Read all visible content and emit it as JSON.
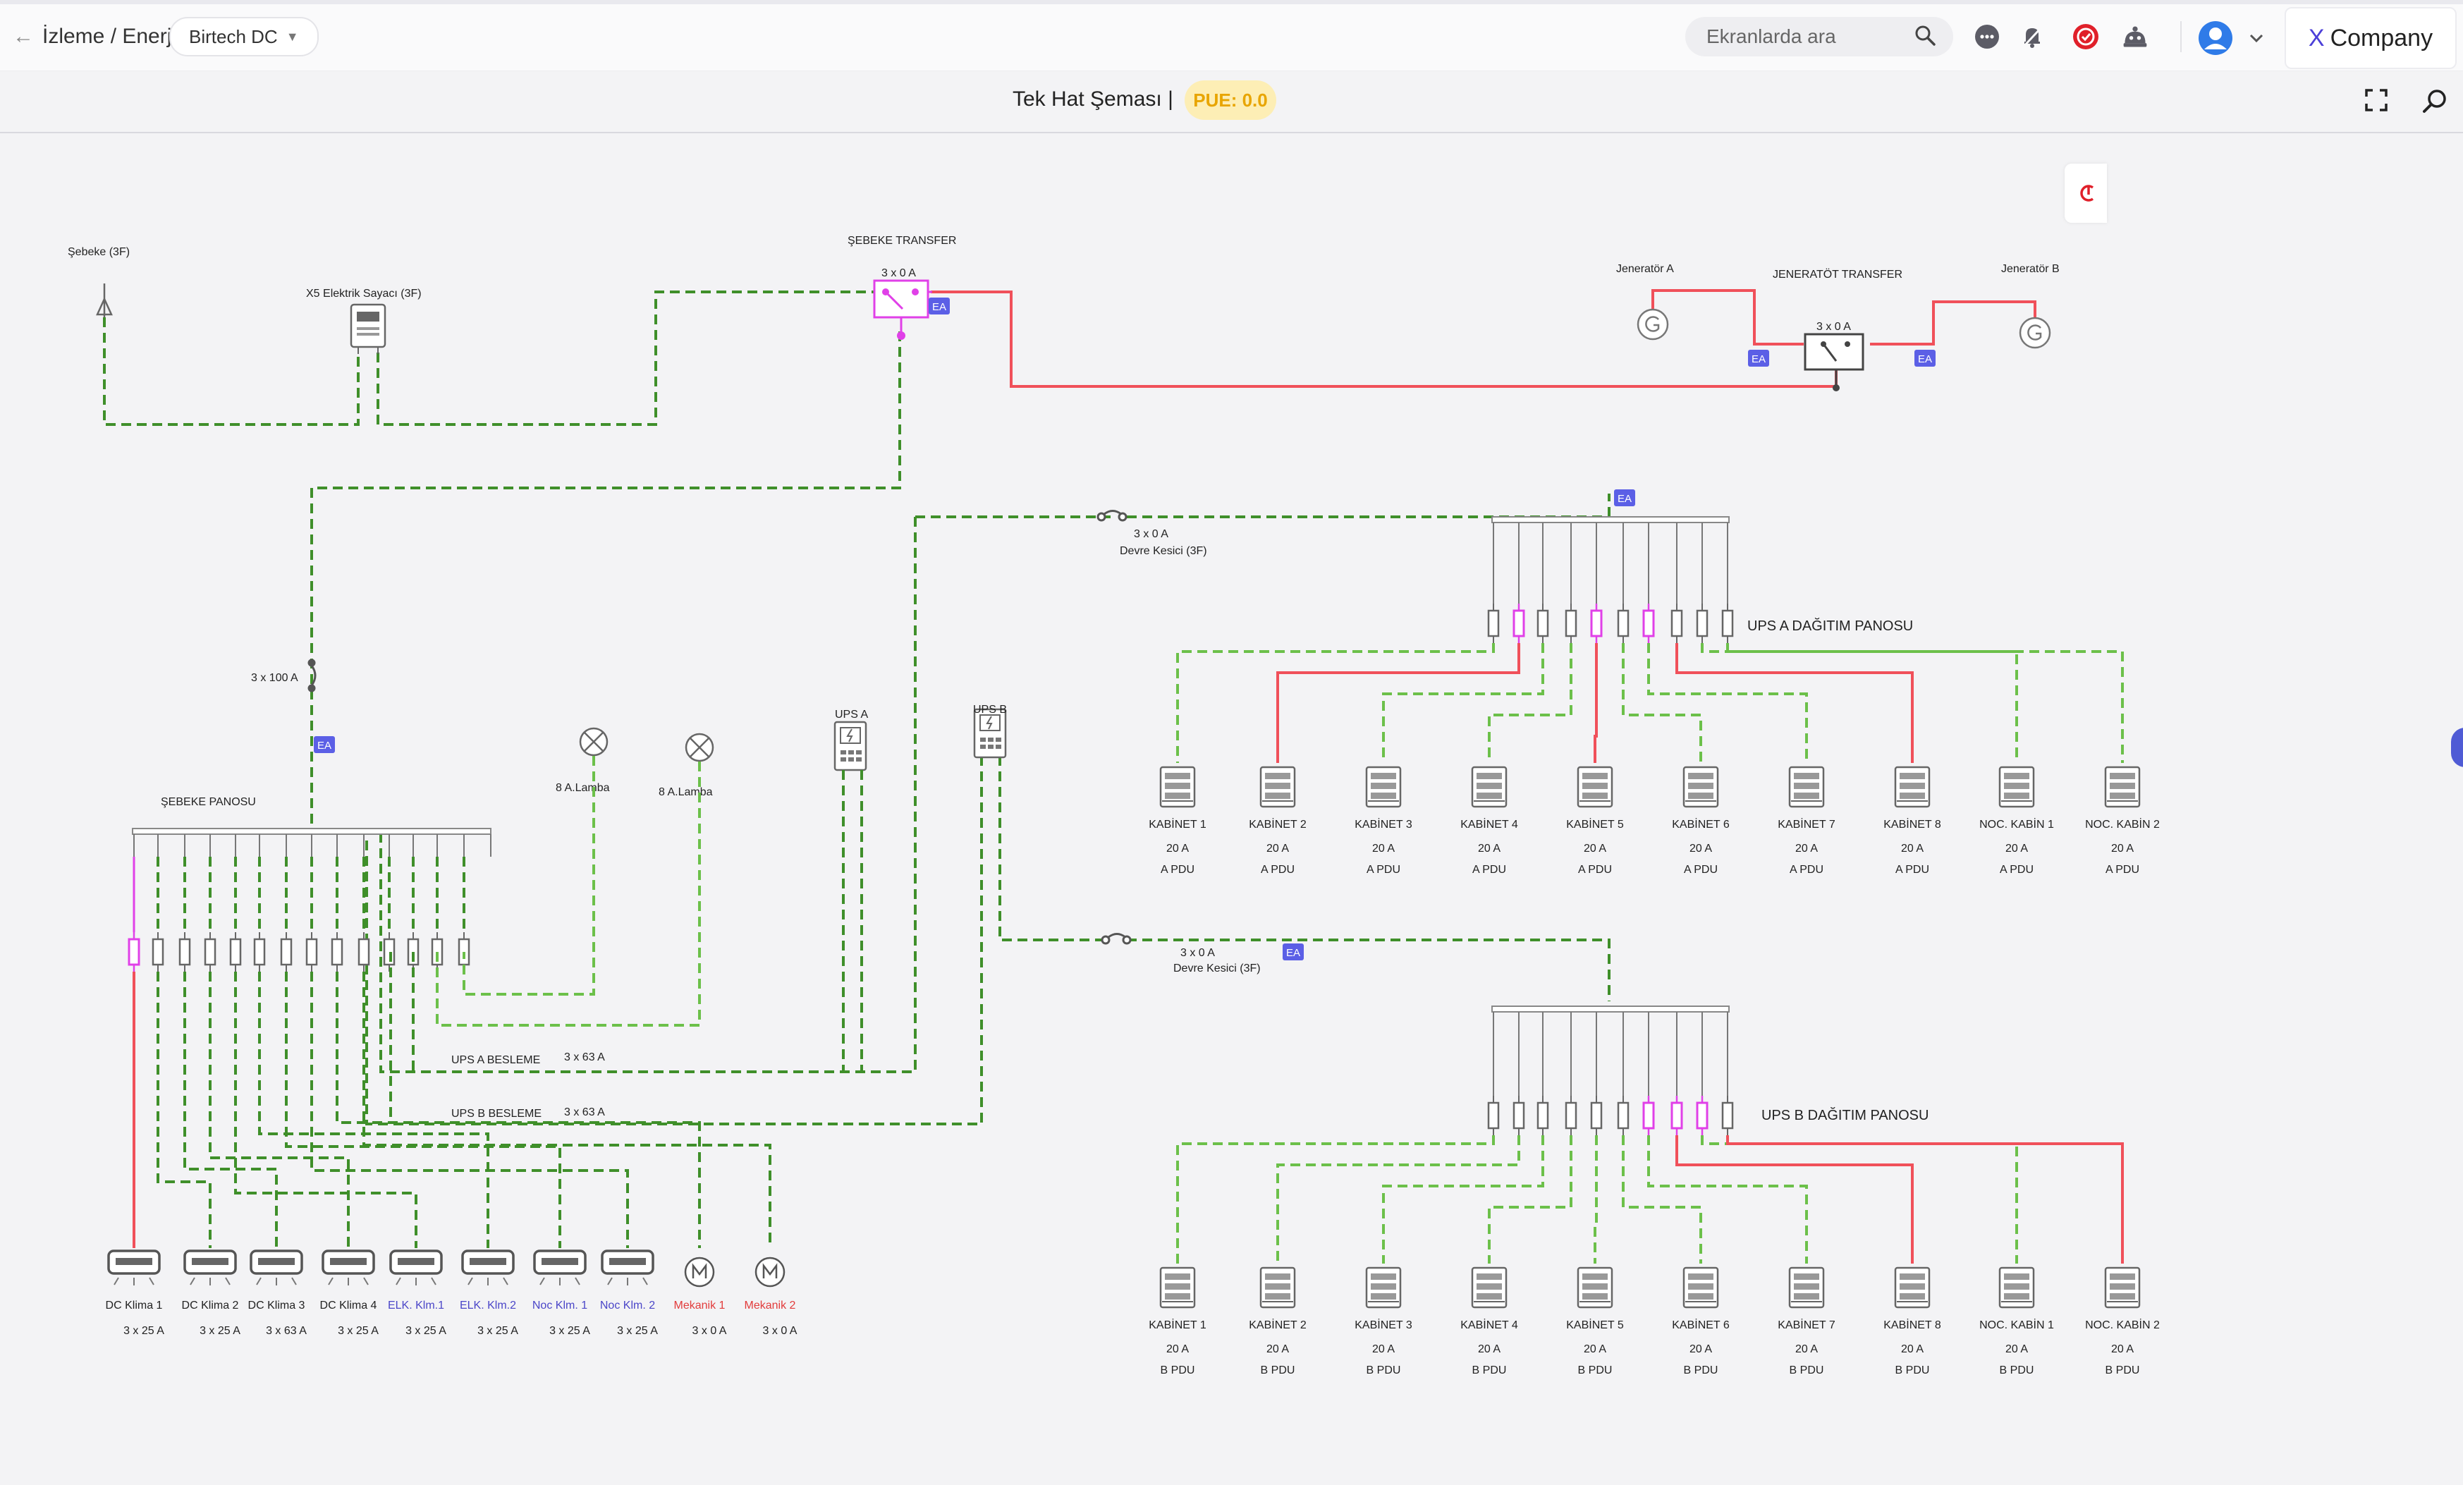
{
  "header": {
    "breadcrumb": "İzleme / Enerji",
    "datacenter": "Birtech DC",
    "search_placeholder": "Ekranlarda ara",
    "company_x": "X",
    "company_name": "Company"
  },
  "toolbar": {
    "title": "Tek Hat Şeması |",
    "pue": "PUE: 0.0"
  },
  "colors": {
    "grid_green": "#3f8f2a",
    "ups_green": "#6cc04a",
    "power_red": "#f0505a",
    "breaker_magenta": "#e040e8",
    "ea_badge": "#5b5fe6"
  },
  "diagram": {
    "grid": {
      "label": "Şebeke (3F)"
    },
    "meter": {
      "label": "X5 Elektrik Sayacı (3F)"
    },
    "grid_transfer": {
      "label": "ŞEBEKE TRANSFER",
      "rating": "3 x 0 A"
    },
    "gen_a": {
      "label": "Jeneratör A"
    },
    "gen_b": {
      "label": "Jeneratör B"
    },
    "gen_transfer": {
      "label": "JENERATÖT TRANSFER",
      "rating": "3 x 0 A"
    },
    "main_breaker": {
      "rating": "3 x 100 A"
    },
    "ea_badge": "EA",
    "grid_panel": {
      "label": "ŞEBEKE PANOSU"
    },
    "lamps": [
      {
        "label": "8 A.Lamba"
      },
      {
        "label": "8 A.Lamba"
      }
    ],
    "ups_a": {
      "label": "UPS A"
    },
    "ups_b": {
      "label": "UPS B"
    },
    "ups_a_feed": {
      "label": "UPS A BESLEME",
      "rating": "3 x 63 A"
    },
    "ups_b_feed": {
      "label": "UPS B BESLEME",
      "rating": "3 x 63 A"
    },
    "breaker_a": {
      "rating": "3 x 0 A",
      "label": "Devre Kesici (3F)"
    },
    "breaker_b": {
      "rating": "3 x 0 A",
      "label": "Devre Kesici (3F)"
    },
    "ups_a_panel": {
      "label": "UPS A DAĞITIM PANOSU"
    },
    "ups_b_panel": {
      "label": "UPS B DAĞITIM PANOSU"
    },
    "cabinets_a": [
      {
        "name": "KABİNET 1",
        "amp": "20 A",
        "pdu": "A PDU"
      },
      {
        "name": "KABİNET 2",
        "amp": "20 A",
        "pdu": "A PDU"
      },
      {
        "name": "KABİNET 3",
        "amp": "20 A",
        "pdu": "A PDU"
      },
      {
        "name": "KABİNET 4",
        "amp": "20 A",
        "pdu": "A PDU"
      },
      {
        "name": "KABİNET 5",
        "amp": "20 A",
        "pdu": "A PDU"
      },
      {
        "name": "KABİNET 6",
        "amp": "20 A",
        "pdu": "A PDU"
      },
      {
        "name": "KABİNET 7",
        "amp": "20 A",
        "pdu": "A PDU"
      },
      {
        "name": "KABİNET 8",
        "amp": "20 A",
        "pdu": "A PDU"
      },
      {
        "name": "NOC. KABİN 1",
        "amp": "20 A",
        "pdu": "A PDU"
      },
      {
        "name": "NOC. KABİN 2",
        "amp": "20 A",
        "pdu": "A PDU"
      }
    ],
    "cabinets_b": [
      {
        "name": "KABİNET 1",
        "amp": "20 A",
        "pdu": "B PDU"
      },
      {
        "name": "KABİNET 2",
        "amp": "20 A",
        "pdu": "B PDU"
      },
      {
        "name": "KABİNET 3",
        "amp": "20 A",
        "pdu": "B PDU"
      },
      {
        "name": "KABİNET 4",
        "amp": "20 A",
        "pdu": "B PDU"
      },
      {
        "name": "KABİNET 5",
        "amp": "20 A",
        "pdu": "B PDU"
      },
      {
        "name": "KABİNET 6",
        "amp": "20 A",
        "pdu": "B PDU"
      },
      {
        "name": "KABİNET 7",
        "amp": "20 A",
        "pdu": "B PDU"
      },
      {
        "name": "KABİNET 8",
        "amp": "20 A",
        "pdu": "B PDU"
      },
      {
        "name": "NOC. KABİN 1",
        "amp": "20 A",
        "pdu": "B PDU"
      },
      {
        "name": "NOC. KABİN 2",
        "amp": "20 A",
        "pdu": "B PDU"
      }
    ],
    "loads": [
      {
        "name": "DC Klima 1",
        "rating": "3 x 25 A",
        "kind": "ac",
        "tone": "normal"
      },
      {
        "name": "DC Klima 2",
        "rating": "3 x 25 A",
        "kind": "ac",
        "tone": "normal"
      },
      {
        "name": "DC Klima 3",
        "rating": "3 x 63 A",
        "kind": "ac",
        "tone": "normal"
      },
      {
        "name": "DC Klima 4",
        "rating": "3 x 25 A",
        "kind": "ac",
        "tone": "normal"
      },
      {
        "name": "ELK. Klm.1",
        "rating": "3 x 25 A",
        "kind": "ac",
        "tone": "blue"
      },
      {
        "name": "ELK. Klm.2",
        "rating": "3 x 25 A",
        "kind": "ac",
        "tone": "blue"
      },
      {
        "name": "Noc Klm. 1",
        "rating": "3 x 25 A",
        "kind": "ac",
        "tone": "blue"
      },
      {
        "name": "Noc Klm. 2",
        "rating": "3 x 25 A",
        "kind": "ac",
        "tone": "blue"
      },
      {
        "name": "Mekanik 1",
        "rating": "3 x 0 A",
        "kind": "motor",
        "tone": "red"
      },
      {
        "name": "Mekanik 2",
        "rating": "3 x 0 A",
        "kind": "motor",
        "tone": "red"
      }
    ]
  }
}
